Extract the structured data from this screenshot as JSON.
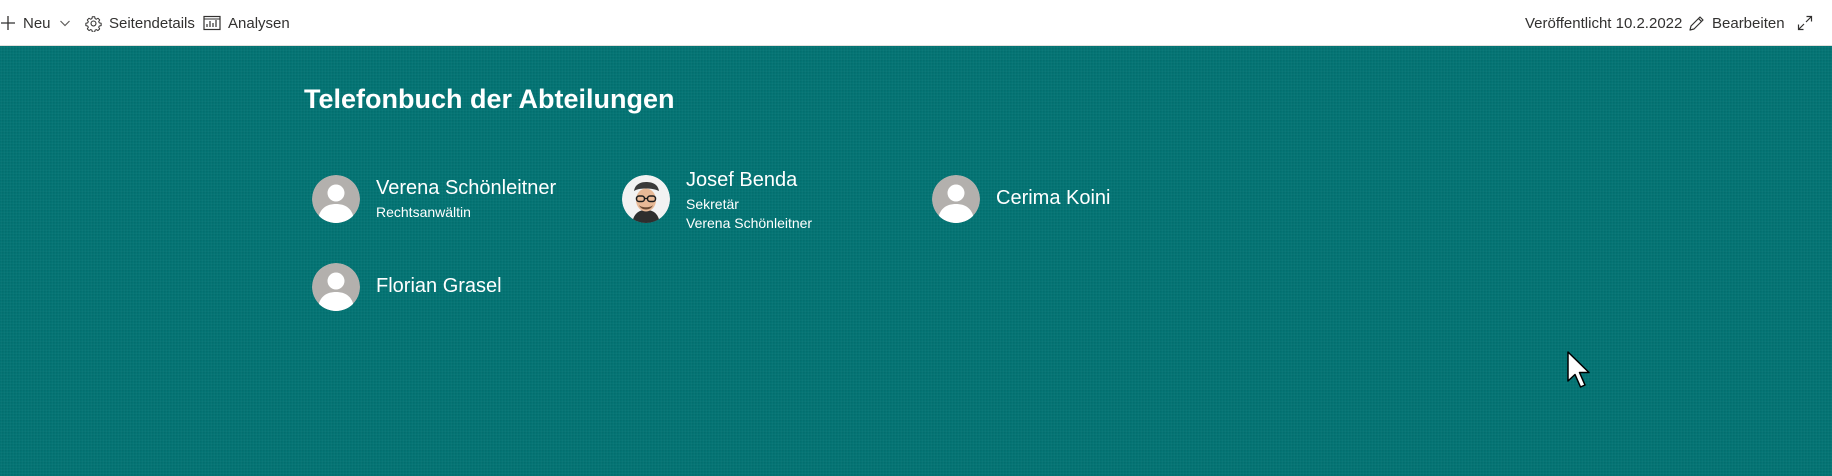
{
  "command_bar": {
    "new_label": "Neu",
    "page_details_label": "Seitendetails",
    "analytics_label": "Analysen",
    "published_text": "Veröffentlicht 10.2.2022",
    "edit_label": "Bearbeiten"
  },
  "page": {
    "background_color": "#037474",
    "title": "Telefonbuch der Abteilungen",
    "people": [
      {
        "name": "Verena Schönleitner",
        "title": "Rechtsanwältin",
        "avatar": "placeholder"
      },
      {
        "name": "Josef Benda",
        "title": "Sekretär",
        "manager": "Verena Schönleitner",
        "avatar": "photo"
      },
      {
        "name": "Cerima Koini",
        "avatar": "placeholder"
      },
      {
        "name": "Florian Grasel",
        "avatar": "placeholder"
      }
    ]
  }
}
